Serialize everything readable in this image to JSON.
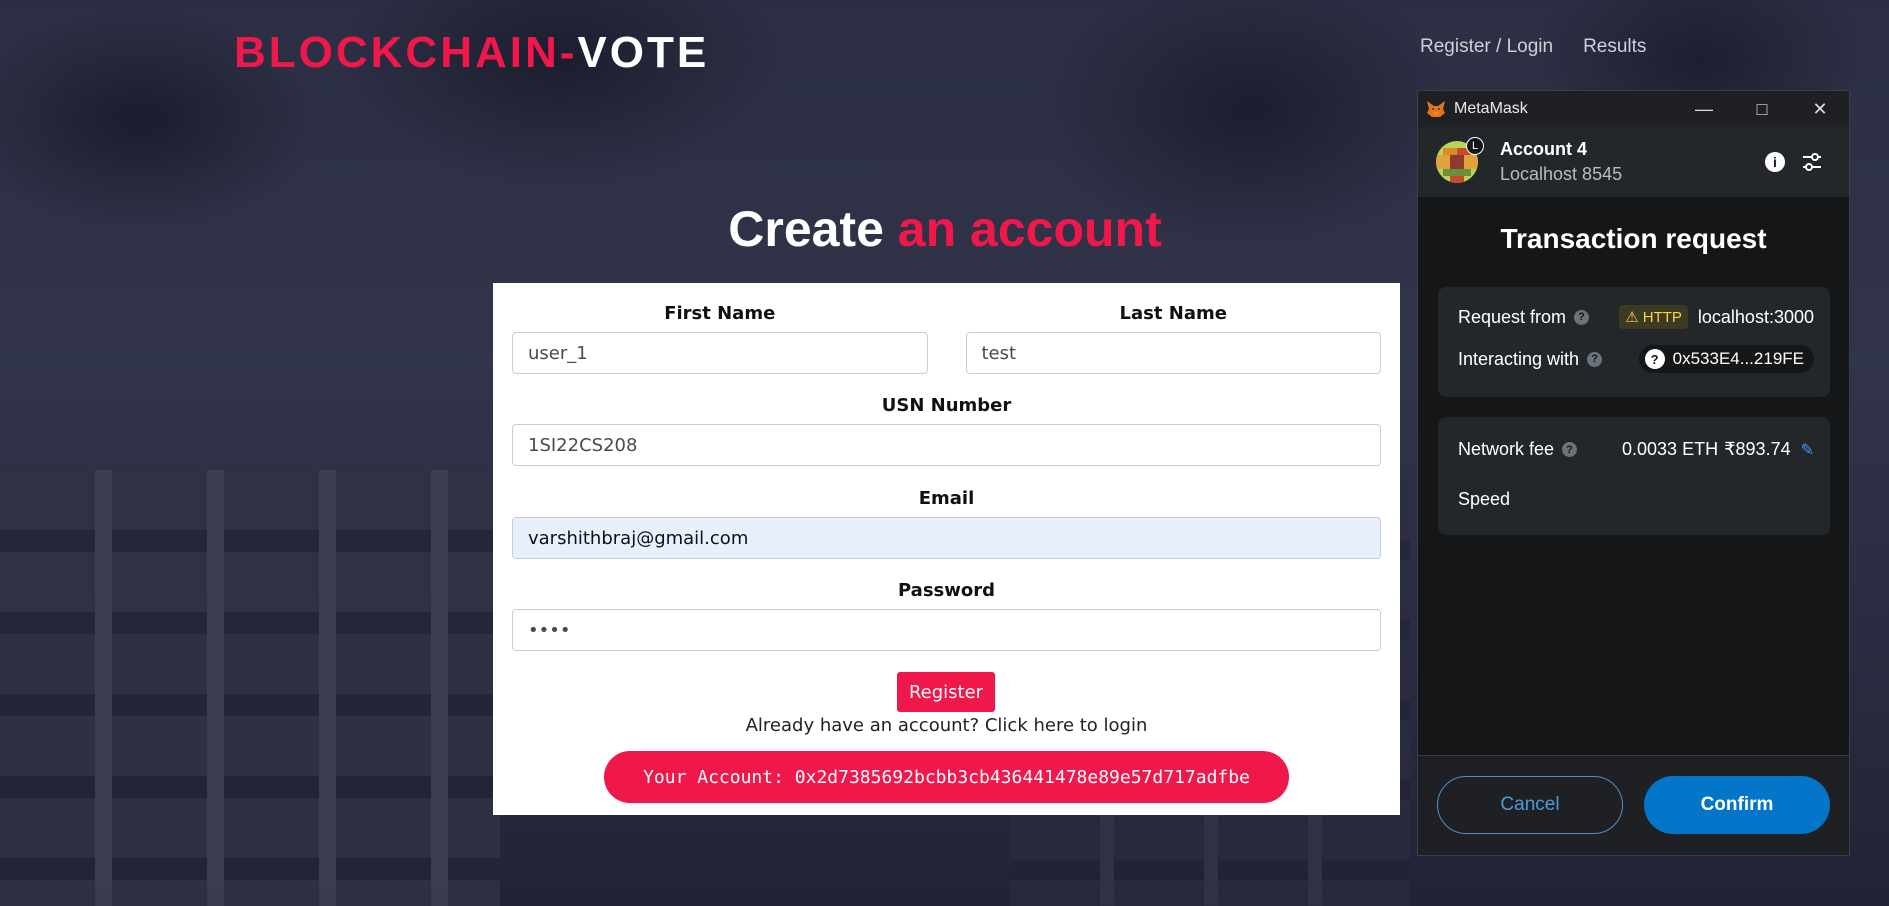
{
  "header": {
    "logo_part1": "BLOCKCHAIN-",
    "logo_part2": "VOTE",
    "nav": [
      "Register / Login",
      "Results"
    ]
  },
  "page": {
    "title_white": "Create",
    "title_accent": "an account"
  },
  "form": {
    "first_name_label": "First Name",
    "first_name_value": "user_1",
    "last_name_label": "Last Name",
    "last_name_value": "test",
    "usn_label": "USN Number",
    "usn_value": "1SI22CS208",
    "email_label": "Email",
    "email_value": "varshithbraj@gmail.com",
    "password_label": "Password",
    "password_value": "••••",
    "register_label": "Register",
    "login_text": "Already have an account? Click here to login",
    "account_text": "Your Account: 0x2d7385692bcbb3cb436441478e89e57d717adfbe"
  },
  "metamask": {
    "window_title": "MetaMask",
    "account_name": "Account 4",
    "network": "Localhost 8545",
    "avatar_badge": "L",
    "heading": "Transaction request",
    "request_from_label": "Request from",
    "http_badge": "HTTP",
    "request_from_value": "localhost:3000",
    "interacting_with_label": "Interacting with",
    "interacting_with_value": "0x533E4...219FE",
    "network_fee_label": "Network fee",
    "network_fee_eth": "0.0033 ETH",
    "network_fee_fiat": "₹893.74",
    "speed_label": "Speed",
    "cancel_label": "Cancel",
    "confirm_label": "Confirm"
  },
  "colors": {
    "accent": "#f0174b",
    "metamask_blue": "#0376c9"
  }
}
